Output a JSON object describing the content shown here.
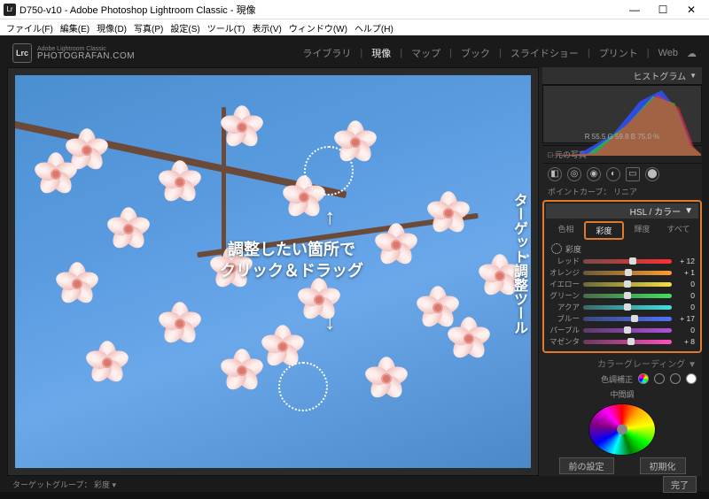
{
  "window": {
    "title": "D750-v10 - Adobe Photoshop Lightroom Classic - 現像"
  },
  "menu": [
    "ファイル(F)",
    "編集(E)",
    "現像(D)",
    "写真(P)",
    "設定(S)",
    "ツール(T)",
    "表示(V)",
    "ウィンドウ(W)",
    "ヘルプ(H)"
  ],
  "brand": {
    "badge": "Lrc",
    "line1": "Adobe Lightroom Classic",
    "line2": "PHOTOGRAFAN.COM"
  },
  "modules": [
    "ライブラリ",
    "現像",
    "マップ",
    "ブック",
    "スライドショー",
    "プリント",
    "Web"
  ],
  "histogram": {
    "title": "ヒストグラム",
    "readout": "R  55.5   G  59.8   B  75.0 %"
  },
  "orig_label": "□ 元の写真",
  "hsl": {
    "title": "HSL / カラー",
    "tabs": [
      "色相",
      "彩度",
      "輝度",
      "すべて"
    ],
    "tat_label": "彩度",
    "sliders": [
      {
        "name": "レッド",
        "grad": "linear-gradient(90deg,#7a4a4a,#ff3030)",
        "pos": 56,
        "val": "+ 12"
      },
      {
        "name": "オレンジ",
        "grad": "linear-gradient(90deg,#6a5a3a,#ff9a30)",
        "pos": 51,
        "val": "+ 1"
      },
      {
        "name": "イエロー",
        "grad": "linear-gradient(90deg,#6a6a3a,#f5e040)",
        "pos": 50,
        "val": "0"
      },
      {
        "name": "グリーン",
        "grad": "linear-gradient(90deg,#4a6a4a,#40e060)",
        "pos": 50,
        "val": "0"
      },
      {
        "name": "アクア",
        "grad": "linear-gradient(90deg,#3a6a6a,#40e0e0)",
        "pos": 50,
        "val": "0"
      },
      {
        "name": "ブルー",
        "grad": "linear-gradient(90deg,#3a4a7a,#5070ff)",
        "pos": 58,
        "val": "+ 17"
      },
      {
        "name": "パープル",
        "grad": "linear-gradient(90deg,#5a3a6a,#b050e0)",
        "pos": 50,
        "val": "0"
      },
      {
        "name": "マゼンタ",
        "grad": "linear-gradient(90deg,#6a3a5a,#ff50c0)",
        "pos": 54,
        "val": "+ 8"
      }
    ]
  },
  "color_grading": {
    "title": "カラーグレーディング",
    "tone_label": "色調補正",
    "mid_label": "中間調"
  },
  "point_curve": "ポイントカーブ：  リニア",
  "annotations": {
    "main_line1": "調整したい箇所で",
    "main_line2": "クリック＆ドラッグ",
    "side": "ターゲット調整ツール"
  },
  "footer": {
    "group_label": "ターゲットグループ：",
    "group_value": "彩度 ▾",
    "done": "完了",
    "prev": "前の設定",
    "reset": "初期化"
  }
}
